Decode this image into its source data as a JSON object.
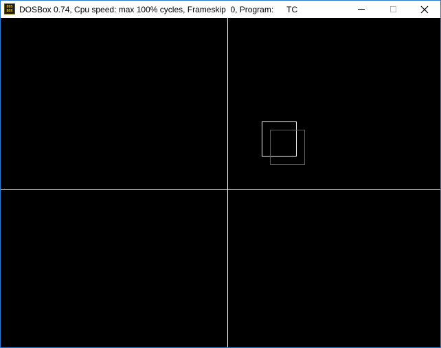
{
  "window": {
    "title": "DOSBox 0.74, Cpu speed: max 100% cycles, Frameskip  0, Program:",
    "program": "TC",
    "icon_top_text": "DOS",
    "icon_bottom_text": "BOX",
    "controls": {
      "minimize": "minimize-icon",
      "maximize": "maximize-icon",
      "close": "close-icon"
    }
  },
  "screen": {
    "background_color": "#000000",
    "axis_color": "#ffffff",
    "square_1_color": "#ffffff",
    "square_2_color": "#00a000"
  }
}
